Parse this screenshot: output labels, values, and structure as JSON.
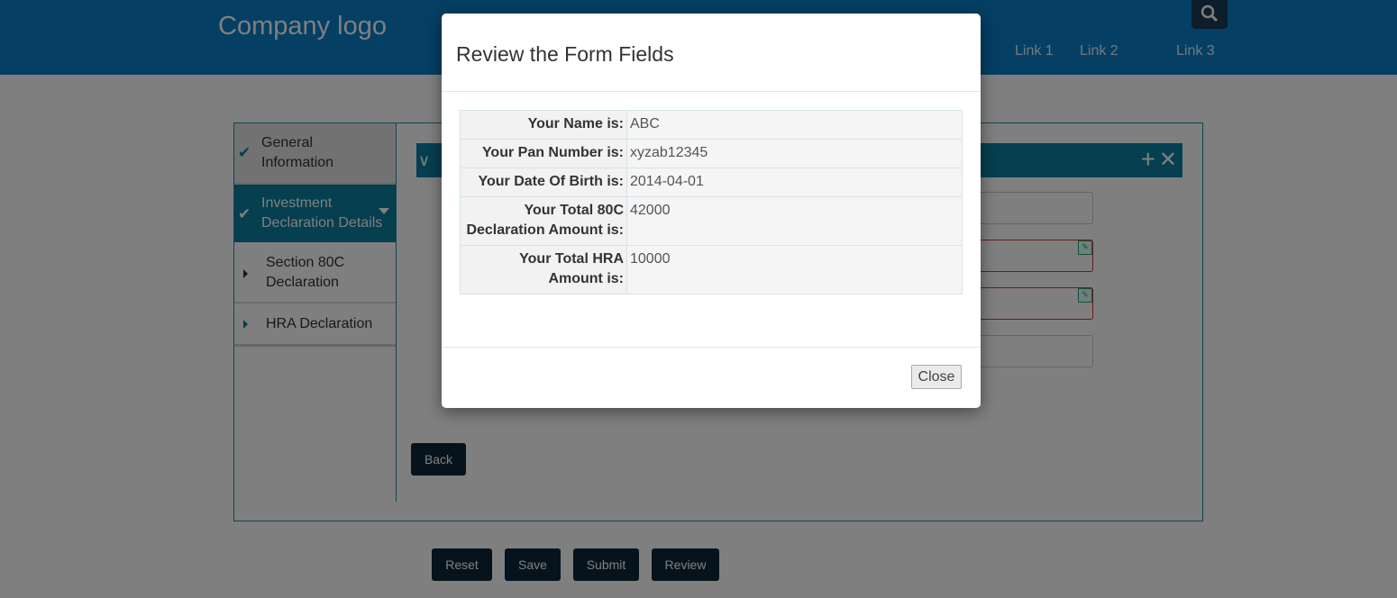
{
  "header": {
    "logo": "Company logo",
    "links": [
      "Link 1",
      "Link 2",
      "Link 3"
    ]
  },
  "sidebar": {
    "items": [
      {
        "label": "General Information",
        "icon": "check-icon"
      },
      {
        "label": "Investment Declaration Details",
        "icon": "check-icon"
      },
      {
        "label": "Section 80C Declaration",
        "icon": "triangle-right-icon"
      },
      {
        "label": "HRA Declaration",
        "icon": "triangle-right-icon"
      }
    ]
  },
  "buttons": {
    "back": "Back",
    "reset": "Reset",
    "save": "Save",
    "submit": "Submit",
    "review": "Review"
  },
  "modal": {
    "title": "Review the Form Fields",
    "rows": [
      {
        "label": "Your Name is:",
        "value": "ABC"
      },
      {
        "label": "Your Pan Number is:",
        "value": "xyzab12345"
      },
      {
        "label": "Your Date Of Birth is:",
        "value": "2014-04-01"
      },
      {
        "label": "Your Total 80C Declaration Amount is:",
        "value": "42000"
      },
      {
        "label": "Your Total HRA Amount is:",
        "value": "10000"
      }
    ],
    "close_label": "Close"
  },
  "colors": {
    "header_blue": "#0a7fc9",
    "teal": "#0a7fa0",
    "dark_button": "#0d2638"
  }
}
